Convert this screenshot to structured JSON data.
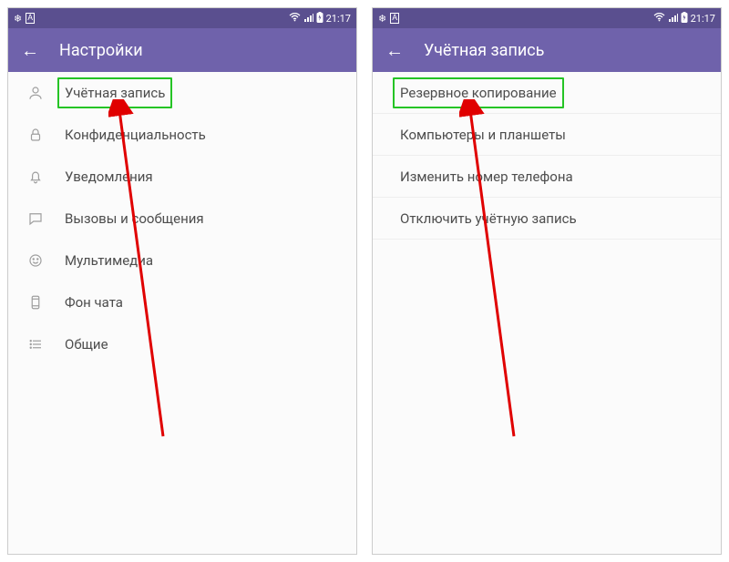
{
  "status": {
    "time": "21:17"
  },
  "screen1": {
    "title": "Настройки",
    "items": [
      {
        "label": "Учётная запись",
        "icon": "user",
        "highlight": true
      },
      {
        "label": "Конфиденциальность",
        "icon": "lock"
      },
      {
        "label": "Уведомления",
        "icon": "bell"
      },
      {
        "label": "Вызовы и сообщения",
        "icon": "chat"
      },
      {
        "label": "Мультимедиа",
        "icon": "smile"
      },
      {
        "label": "Фон чата",
        "icon": "phone-bg"
      },
      {
        "label": "Общие",
        "icon": "list"
      }
    ]
  },
  "screen2": {
    "title": "Учётная запись",
    "items": [
      {
        "label": "Резервное копирование",
        "highlight": true
      },
      {
        "label": "Компьютеры и планшеты"
      },
      {
        "label": "Изменить номер телефона"
      },
      {
        "label": "Отключить учётную запись"
      }
    ]
  }
}
